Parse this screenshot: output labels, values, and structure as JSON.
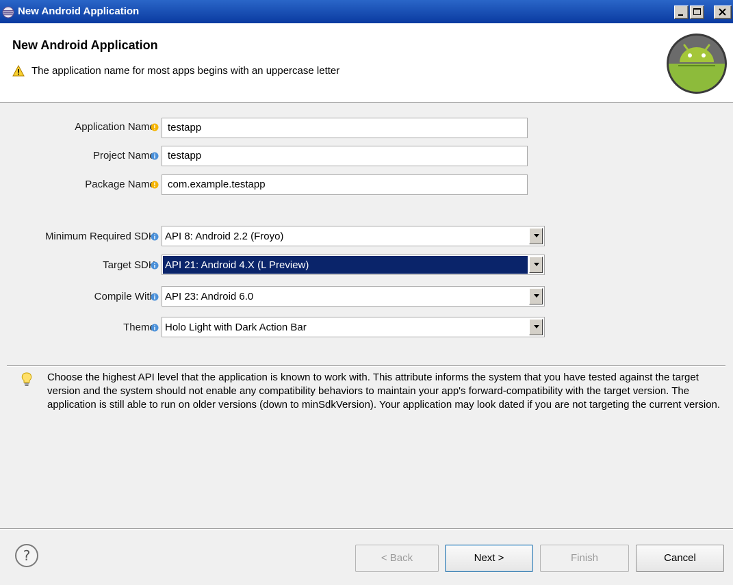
{
  "window": {
    "title": "New Android Application"
  },
  "header": {
    "title": "New Android Application",
    "message": "The application name for most apps begins with an uppercase letter"
  },
  "form": {
    "application_name": {
      "label": "Application Name:",
      "value": "testapp",
      "decoration": "warning-icon"
    },
    "project_name": {
      "label": "Project Name:",
      "value": "testapp",
      "decoration": "info-icon"
    },
    "package_name": {
      "label": "Package Name:",
      "value": "com.example.testapp",
      "decoration": "warning-icon"
    },
    "min_sdk": {
      "label": "Minimum Required SDK:",
      "value": "API 8: Android 2.2 (Froyo)",
      "decoration": "info-icon"
    },
    "target_sdk": {
      "label": "Target SDK:",
      "value": "API 21: Android 4.X (L Preview)",
      "decoration": "info-icon"
    },
    "compile_with": {
      "label": "Compile With:",
      "value": "API 23: Android 6.0",
      "decoration": "info-icon"
    },
    "theme": {
      "label": "Theme:",
      "value": "Holo Light with Dark Action Bar",
      "decoration": "info-icon"
    }
  },
  "help": {
    "text": "Choose the highest API level that the application is known to work with. This attribute informs the system that you have tested against the target version and the system should not enable any compatibility behaviors to maintain your app's forward-compatibility with the target version. The application is still able to run on older versions (down to minSdkVersion). Your application may look dated if you are not targeting the current version."
  },
  "buttons": {
    "back": "< Back",
    "next": "Next >",
    "finish": "Finish",
    "cancel": "Cancel"
  },
  "colors": {
    "titlebar": "#0a3aa0",
    "selection": "#0a246a",
    "android_green": "#8dbb3b"
  }
}
